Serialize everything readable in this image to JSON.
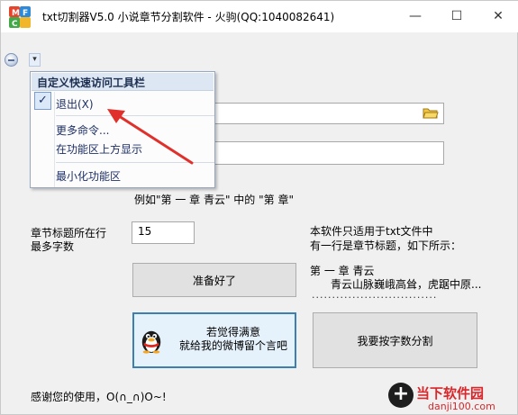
{
  "window": {
    "title": "txt切割器V5.0 小说章节分割软件 - 火驹(QQ:1040082641)",
    "minimize_glyph": "—",
    "maximize_glyph": "☐",
    "close_glyph": "✕"
  },
  "qat": {
    "dropdown_glyph": "▾"
  },
  "menu": {
    "header": "自定义快速访问工具栏",
    "check_glyph": "✓",
    "items": [
      {
        "label": "退出(X)"
      },
      {
        "label": "更多命令..."
      },
      {
        "label": "在功能区上方显示"
      },
      {
        "label": "最小化功能区"
      }
    ]
  },
  "form": {
    "example_text": "例如\"第 一 章   青云\" 中的 \"第 章\"",
    "max_chars_label_1": "章节标题所在行",
    "max_chars_label_2": "最多字数",
    "max_chars_value": "15",
    "info_line_1": "本软件只适用于txt文件中",
    "info_line_2": "有一行是章节标题，如下所示：",
    "sample_title": "第 一 章   青云",
    "sample_body": "青云山脉巍峨高耸，虎踞中原...",
    "sample_dots": "...............................",
    "ready_button": "准备好了",
    "weibo_line_1": "若觉得满意",
    "weibo_line_2": "就给我的微博留个言吧",
    "split_button": "我要按字数分割",
    "thanks_text": "感谢您的使用，O(∩_∩)O~!"
  },
  "watermark": {
    "glyph": "+",
    "text": "当下软件园",
    "url": "danji100.com"
  },
  "colors": {
    "accent": "#3c7fb1",
    "arrow": "#e0302b",
    "menu_header_bg": "#dde7f3"
  }
}
